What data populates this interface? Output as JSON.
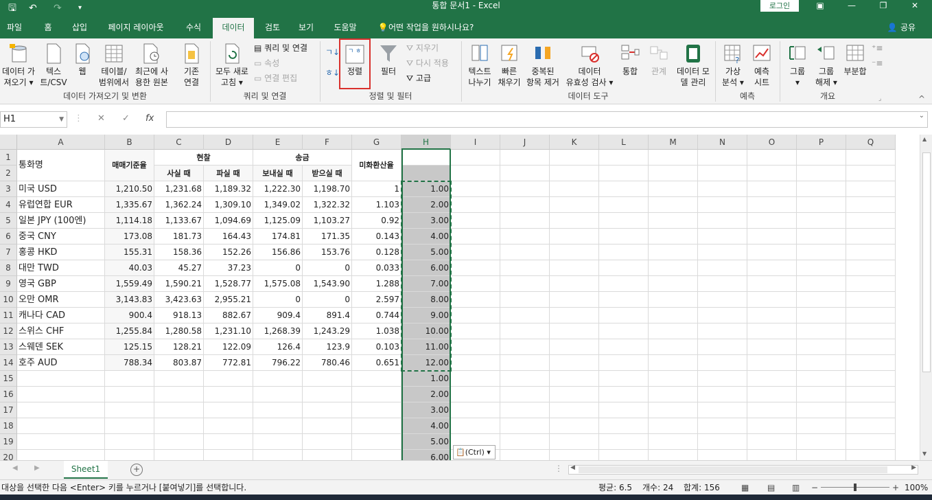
{
  "titlebar": {
    "title": "통합 문서1  -  Excel",
    "login": "로그인"
  },
  "tabs": [
    "파일",
    "홈",
    "삽입",
    "페이지 레이아웃",
    "수식",
    "데이터",
    "검토",
    "보기",
    "도움말"
  ],
  "tell_me": "어떤 작업을 원하시나요?",
  "share": "공유",
  "ribbon": {
    "get_data": "데이터 가\n져오기 ▾",
    "text_csv": "텍스\n트/CSV",
    "web": "웹",
    "table_range": "테이블/\n범위에서",
    "recent": "최근에 사\n용한 원본",
    "existing": "기존\n연결",
    "refresh_all": "모두 새로\n고침 ▾",
    "queries_conn": "쿼리 및 연결",
    "properties": "속성",
    "edit_links": "연결 편집",
    "sort_az": "↓",
    "sort_za": "↓",
    "sort": "정렬",
    "filter": "필터",
    "clear": "지우기",
    "reapply": "다시 적용",
    "advanced": "고급",
    "text_to_cols": "텍스트\n나누기",
    "flash_fill": "빠른\n채우기",
    "remove_dup": "중복된\n항목 제거",
    "validation": "데이터\n유효성 검사 ▾",
    "consolidate": "통합",
    "relations": "관계",
    "data_model": "데이터 모\n델 관리",
    "whatif": "가상\n분석 ▾",
    "forecast": "예측\n시트",
    "group": "그룹\n▾",
    "ungroup": "그룹\n해제 ▾",
    "subtotal": "부분합",
    "groups": [
      "데이터 가져오기 및 변환",
      "쿼리 및 연결",
      "정렬 및 필터",
      "데이터 도구",
      "예측",
      "개요"
    ]
  },
  "formula": {
    "namebox": "H1",
    "cancel": "✕",
    "enter": "✓",
    "fx": "fx",
    "value": ""
  },
  "columns": [
    "A",
    "B",
    "C",
    "D",
    "E",
    "F",
    "G",
    "H",
    "I",
    "J",
    "K",
    "L",
    "M",
    "N",
    "O",
    "P",
    "Q"
  ],
  "rows": [
    "1",
    "2",
    "3",
    "4",
    "5",
    "6",
    "7",
    "8",
    "9",
    "10",
    "11",
    "12",
    "13",
    "14",
    "15",
    "16",
    "17",
    "18",
    "19",
    "20"
  ],
  "header": {
    "currency": "통화명",
    "base_rate": "매매기준율",
    "cash": "현찰",
    "buy": "사실 때",
    "sell": "파실 때",
    "transfer": "송금",
    "send": "보내실 때",
    "receive": "받으실 때",
    "usd_rate": "미화환산율"
  },
  "table": [
    [
      "미국 USD",
      "1,210.50",
      "1,231.68",
      "1,189.32",
      "1,222.30",
      "1,198.70",
      "1",
      "1.00"
    ],
    [
      "유럽연합 EUR",
      "1,335.67",
      "1,362.24",
      "1,309.10",
      "1,349.02",
      "1,322.32",
      "1.103",
      "2.00"
    ],
    [
      "일본 JPY (100엔)",
      "1,114.18",
      "1,133.67",
      "1,094.69",
      "1,125.09",
      "1,103.27",
      "0.92",
      "3.00"
    ],
    [
      "중국 CNY",
      "173.08",
      "181.73",
      "164.43",
      "174.81",
      "171.35",
      "0.143",
      "4.00"
    ],
    [
      "홍콩 HKD",
      "155.31",
      "158.36",
      "152.26",
      "156.86",
      "153.76",
      "0.128",
      "5.00"
    ],
    [
      "대만 TWD",
      "40.03",
      "45.27",
      "37.23",
      "0",
      "0",
      "0.033",
      "6.00"
    ],
    [
      "영국 GBP",
      "1,559.49",
      "1,590.21",
      "1,528.77",
      "1,575.08",
      "1,543.90",
      "1.288",
      "7.00"
    ],
    [
      "오만 OMR",
      "3,143.83",
      "3,423.63",
      "2,955.21",
      "0",
      "0",
      "2.597",
      "8.00"
    ],
    [
      "캐나다 CAD",
      "900.4",
      "918.13",
      "882.67",
      "909.4",
      "891.4",
      "0.744",
      "9.00"
    ],
    [
      "스위스 CHF",
      "1,255.84",
      "1,280.58",
      "1,231.10",
      "1,268.39",
      "1,243.29",
      "1.038",
      "10.00"
    ],
    [
      "스웨덴 SEK",
      "125.15",
      "128.21",
      "122.09",
      "126.4",
      "123.9",
      "0.103",
      "11.00"
    ],
    [
      "호주 AUD",
      "788.34",
      "803.87",
      "772.81",
      "796.22",
      "780.46",
      "0.651",
      "12.00"
    ]
  ],
  "extra_h": [
    "1.00",
    "2.00",
    "3.00",
    "4.00",
    "5.00",
    "6.00"
  ],
  "paste_ctrl": "(Ctrl) ▾",
  "sheet": {
    "name": "Sheet1",
    "add": "+"
  },
  "status": {
    "message": "대상을 선택한 다음 <Enter> 키를 누르거나 [붙여넣기]를 선택합니다.",
    "average": "평균: 6.5",
    "count": "개수: 24",
    "sum": "합계: 156",
    "zoom": "100%"
  }
}
